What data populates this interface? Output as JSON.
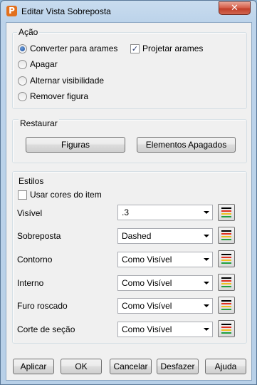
{
  "window": {
    "title": "Editar Vista Sobreposta",
    "app_icon_letter": "P",
    "close_glyph": "✕"
  },
  "acao": {
    "label": "Ação",
    "options": [
      {
        "label": "Converter para arames",
        "checked": true
      },
      {
        "label": "Apagar",
        "checked": false
      },
      {
        "label": "Alternar visibilidade",
        "checked": false
      },
      {
        "label": "Remover figura",
        "checked": false
      }
    ],
    "projetar": {
      "label": "Projetar arames",
      "checked": true
    }
  },
  "restaurar": {
    "label": "Restaurar",
    "figuras": "Figuras",
    "elementos": "Elementos Apagados"
  },
  "estilos": {
    "label": "Estilos",
    "usar_cores": {
      "label": "Usar cores do item",
      "checked": false
    },
    "rows": [
      {
        "label": "Visível",
        "value": ".3"
      },
      {
        "label": "Sobreposta",
        "value": "Dashed"
      },
      {
        "label": "Contorno",
        "value": "Como Visível"
      },
      {
        "label": "Interno",
        "value": "Como Visível"
      },
      {
        "label": "Furo roscado",
        "value": "Como Visível"
      },
      {
        "label": "Corte de seção",
        "value": "Como Visível"
      }
    ]
  },
  "footer": {
    "aplicar": "Aplicar",
    "ok": "OK",
    "cancelar": "Cancelar",
    "desfazer": "Desfazer",
    "ajuda": "Ajuda"
  },
  "colors": {
    "swatch": [
      "#000000",
      "#e03020",
      "#f0c020",
      "#20a040"
    ]
  }
}
